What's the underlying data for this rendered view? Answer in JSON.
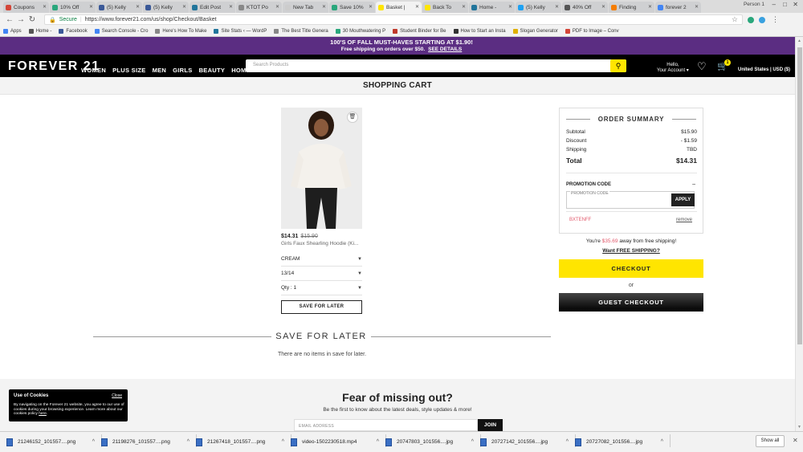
{
  "browser": {
    "tabs": [
      {
        "label": "Coupons",
        "color": "#d44638",
        "active": false
      },
      {
        "label": "10% Off",
        "color": "#2aa77c",
        "active": false
      },
      {
        "label": "(5) Kelly",
        "color": "#3b5998",
        "active": false
      },
      {
        "label": "(5) Kelly",
        "color": "#3b5998",
        "active": false
      },
      {
        "label": "Edit Post",
        "color": "#21759b",
        "active": false
      },
      {
        "label": "KTOT Po",
        "color": "#888888",
        "active": false
      },
      {
        "label": "New Tab",
        "color": "#cccccc",
        "active": false
      },
      {
        "label": "Save 10%",
        "color": "#2aa77c",
        "active": false
      },
      {
        "label": "Basket |",
        "color": "#ffe500",
        "active": true
      },
      {
        "label": "Back To",
        "color": "#ffe500",
        "active": false
      },
      {
        "label": "Home -",
        "color": "#21759b",
        "active": false
      },
      {
        "label": "(5) Kelly",
        "color": "#1da1f2",
        "active": false
      },
      {
        "label": "40% Off",
        "color": "#555555",
        "active": false
      },
      {
        "label": "Finding",
        "color": "#f57d00",
        "active": false
      },
      {
        "label": "forever 2",
        "color": "#4285f4",
        "active": false
      }
    ],
    "person": "Person 1",
    "window_controls": [
      "–",
      "□",
      "✕"
    ],
    "secure_label": "Secure",
    "url": "https://www.forever21.com/us/shop/Checkout/Basket",
    "bookmarks": [
      {
        "label": "Apps",
        "color": "#4285f4"
      },
      {
        "label": "Home -",
        "color": "#555555"
      },
      {
        "label": "Facebook",
        "color": "#3b5998"
      },
      {
        "label": "Search Console - Cro",
        "color": "#4285f4"
      },
      {
        "label": "Here's How To Make",
        "color": "#888888"
      },
      {
        "label": "Site Stats ‹ — WordP",
        "color": "#21759b"
      },
      {
        "label": "The Best Title Genera",
        "color": "#888888"
      },
      {
        "label": "30 Mouthwatering P",
        "color": "#2aa77c"
      },
      {
        "label": "Student Binder for Be",
        "color": "#c0392b"
      },
      {
        "label": "How to Start an Insta",
        "color": "#333333"
      },
      {
        "label": "Slogan Generator",
        "color": "#e0b000"
      },
      {
        "label": "PDF to Image – Conv",
        "color": "#d44638"
      }
    ]
  },
  "promo": {
    "line1": "100'S OF FALL MUST-HAVES STARTING AT $1.90!",
    "line2": "Free shipping on orders over $50.",
    "link": "SEE DETAILS"
  },
  "header": {
    "logo": "FOREVER 21",
    "nav": [
      "WOMEN",
      "PLUS SIZE",
      "MEN",
      "GIRLS",
      "BEAUTY",
      "HOME"
    ],
    "search_placeholder": "Search Products",
    "account_line1": "Hello,",
    "account_line2": "Your Account ▾",
    "cart_count": "1",
    "region": "United States | USD ($)"
  },
  "page_title": "SHOPPING CART",
  "product": {
    "price": "$14.31",
    "original_price": "$15.90",
    "name": "Girls Faux Shearling Hoodie (Ki...",
    "color": "CREAM",
    "size": "13/14",
    "qty": "Qty : 1",
    "save_for_later": "SAVE FOR LATER"
  },
  "summary": {
    "title": "ORDER SUMMARY",
    "rows": [
      {
        "label": "Subtotal",
        "value": "$15.90"
      },
      {
        "label": "Discount",
        "value": "- $1.59"
      },
      {
        "label": "Shipping",
        "value": "TBD"
      }
    ],
    "total_label": "Total",
    "total_value": "$14.31",
    "promo_label": "PROMOTION CODE",
    "promo_dash": "–",
    "promo_placeholder": "PROMOTION CODE",
    "apply": "APPLY",
    "applied_code": "BXTENFF",
    "remove": "remove"
  },
  "shipping": {
    "prefix": "You're",
    "amount": "$35.69",
    "suffix": "away from free shipping!",
    "link": "Want FREE SHIPPING?"
  },
  "checkout": "CHECKOUT",
  "or": "or",
  "guest_checkout": "GUEST CHECKOUT",
  "save_later": {
    "title": "SAVE FOR LATER",
    "empty": "There are no items in save for later."
  },
  "newsletter": {
    "title": "Fear of missing out?",
    "subtitle": "Be the first to know about the latest deals, style updates & more!",
    "email_placeholder": "EMAIL ADDRESS",
    "join": "JOIN"
  },
  "cookies": {
    "title": "Use of Cookies",
    "close": "Close",
    "body": "By navigating on the Forever 21 website, you agree to our use of cookies during your browsing experience. Learn more about our cookies policy",
    "link": "here"
  },
  "downloads": {
    "items": [
      "21246152_101557....png",
      "21198276_101557....png",
      "21267418_101557....png",
      "video-1502230518.mp4",
      "20747803_101556....jpg",
      "20727142_101556....jpg",
      "20727082_101556....jpg"
    ],
    "show_all": "Show all"
  }
}
